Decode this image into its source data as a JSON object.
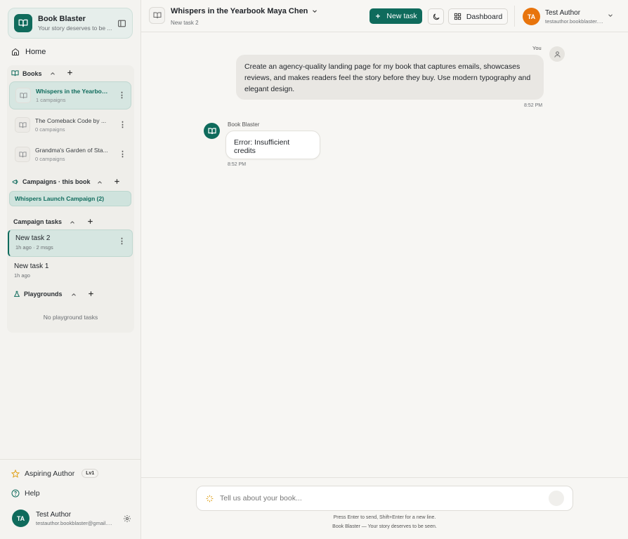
{
  "app": {
    "name": "Book Blaster",
    "tagline": "Your story deserves to be ..."
  },
  "sidebar": {
    "home_label": "Home",
    "books_label": "Books",
    "books": [
      {
        "title": "Whispers in the Yearboo...",
        "campaigns": "1 campaigns",
        "active": true
      },
      {
        "title": "The Comeback Code by ...",
        "campaigns": "0 campaigns",
        "active": false
      },
      {
        "title": "Grandma's Garden of Sta...",
        "campaigns": "0 campaigns",
        "active": false
      }
    ],
    "campaigns_label": "Campaigns · this book",
    "campaign": "Whispers Launch Campaign (2)",
    "tasks_label": "Campaign tasks",
    "tasks": [
      {
        "title": "New task 2",
        "meta": "1h ago · 2 msgs",
        "active": true
      },
      {
        "title": "New task 1",
        "meta": "1h ago",
        "active": false
      }
    ],
    "playgrounds_label": "Playgrounds",
    "playgrounds_empty": "No playground tasks",
    "level_label": "Aspiring Author",
    "level_badge": "Lv1",
    "help_label": "Help",
    "user": {
      "initials": "TA",
      "name": "Test Author",
      "email": "testauthor.bookblaster@gmail.com"
    }
  },
  "header": {
    "title": "Whispers in the Yearbook Maya Chen",
    "subtitle": "New task 2",
    "new_task_label": "New task",
    "dashboard_label": "Dashboard",
    "user": {
      "initials": "TA",
      "name": "Test Author",
      "email": "testauthor.bookblaster.com"
    }
  },
  "chat": {
    "user_label": "You",
    "user_message": "Create an agency-quality landing page for my book that captures emails, showcases reviews, and makes readers feel the story before they buy. Use modern typography and elegant design.",
    "user_time": "8:52 PM",
    "bot_name": "Book Blaster",
    "bot_message": "Error: Insufficient credits",
    "bot_time": "8:52 PM"
  },
  "composer": {
    "placeholder": "Tell us about your book...",
    "hint": "Press Enter to send, Shift+Enter for a new line.",
    "footer": "Book Blaster — Your story deserves to be seen."
  },
  "colors": {
    "brand": "#0f6b5c",
    "avatar_orange": "#e8740c",
    "background": "#f7f6f3"
  }
}
